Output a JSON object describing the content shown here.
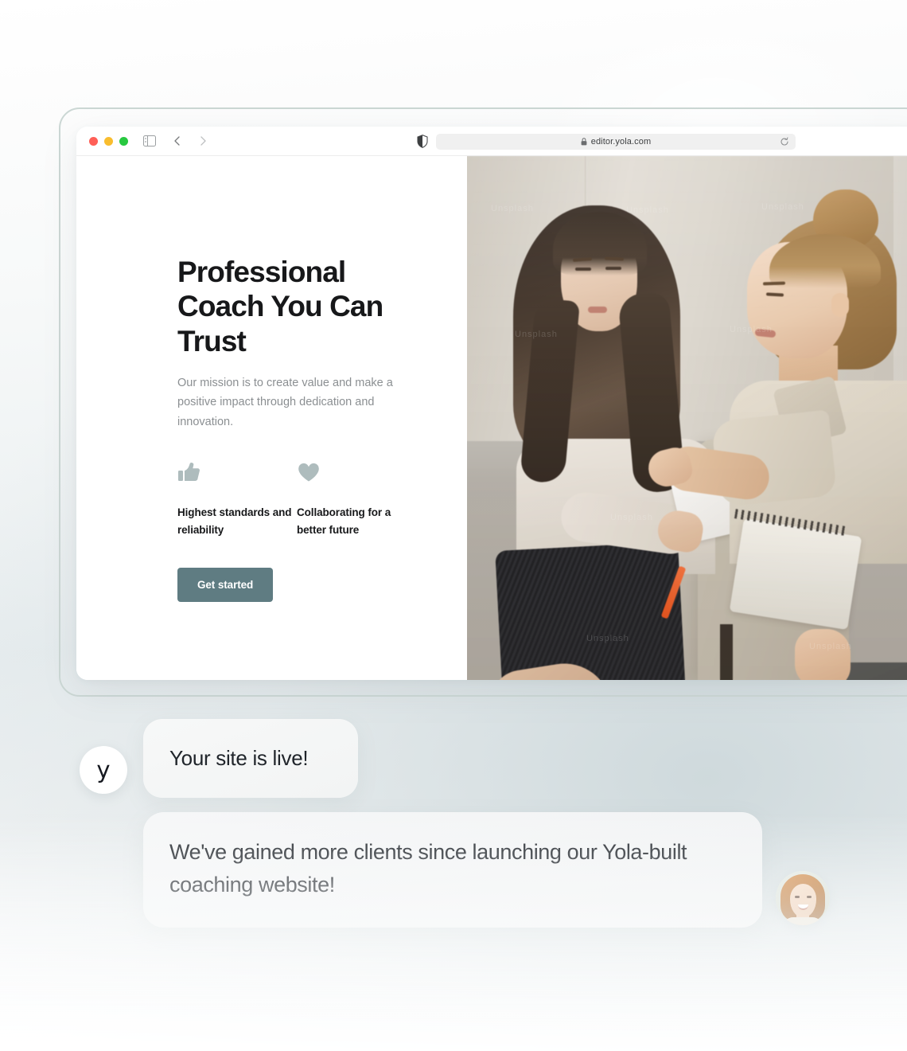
{
  "browser": {
    "traffic_lights": [
      "close",
      "minimize",
      "maximize"
    ],
    "sidebar_toggle_icon": "sidebar-icon",
    "back_icon": "chevron-left-icon",
    "forward_icon": "chevron-right-icon",
    "privacy_icon": "shield-icon",
    "lock_icon": "lock-icon",
    "url": "editor.yola.com",
    "reload_icon": "reload-icon"
  },
  "site": {
    "hero": {
      "title": "Professional Coach You Can Trust",
      "subtitle": "Our mission is to create value and make a positive impact through dedication and innovation.",
      "features": [
        {
          "icon": "thumbs-up-icon",
          "label": "Highest standards and reliability"
        },
        {
          "icon": "heart-icon",
          "label": "Collaborating for a better future"
        }
      ],
      "cta_label": "Get started",
      "cta_color": "#5f7c82",
      "feature_icon_color": "#aebcbd"
    },
    "photo": {
      "alt": "Two women seated on a beige sofa during a coaching session, taking notes",
      "watermarks": [
        "Unsplash",
        "Unsplash",
        "Unsplash",
        "Unsplash",
        "Unsplash",
        "Unsplash",
        "Unsplash",
        "Unsplash"
      ]
    }
  },
  "chat": {
    "brand_mark": "y",
    "messages": [
      {
        "from": "yola",
        "text": "Your site is live!"
      },
      {
        "from": "client",
        "text": "We've gained more clients since launching our Yola-built coaching website!"
      }
    ],
    "client_avatar_alt": "Smiling woman with auburn hair"
  }
}
